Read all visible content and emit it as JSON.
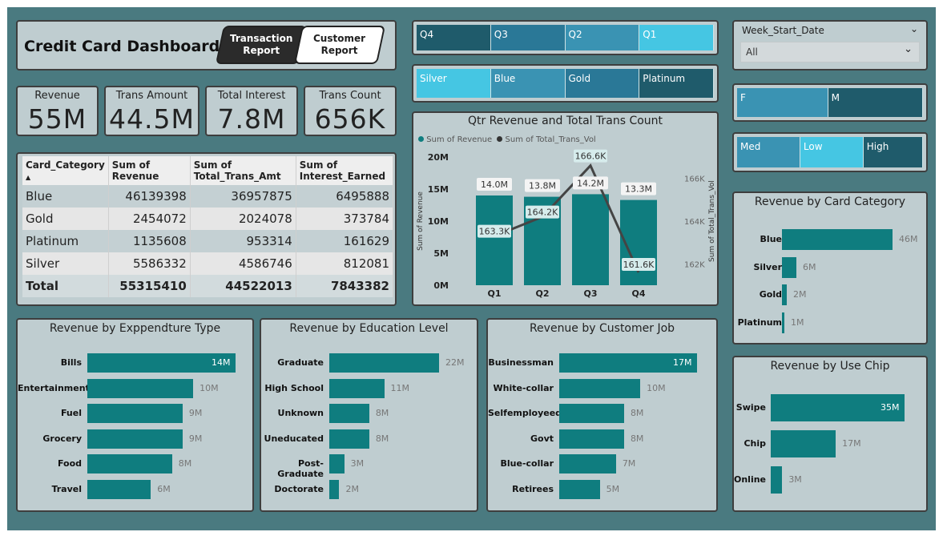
{
  "header": {
    "title": "Credit Card Dashboard",
    "nav": [
      "Transaction\nReport",
      "Customer\nReport"
    ]
  },
  "kpis": [
    {
      "label": "Revenue",
      "value": "55M"
    },
    {
      "label": "Trans Amount",
      "value": "44.5M"
    },
    {
      "label": "Total Interest",
      "value": "7.8M"
    },
    {
      "label": "Trans Count",
      "value": "656K"
    }
  ],
  "table": {
    "headers": [
      "Card_Category",
      "Sum of Revenue",
      "Sum of\nTotal_Trans_Amt",
      "Sum of\nInterest_Earned"
    ],
    "sort_glyph": "▲",
    "rows": [
      [
        "Blue",
        "46139398",
        "36957875",
        "6495888"
      ],
      [
        "Gold",
        "2454072",
        "2024078",
        "373784"
      ],
      [
        "Platinum",
        "1135608",
        "953314",
        "161629"
      ],
      [
        "Silver",
        "5586332",
        "4586746",
        "812081"
      ]
    ],
    "total": [
      "Total",
      "55315410",
      "44522013",
      "7843382"
    ]
  },
  "slicers": {
    "quarters": [
      "Q4",
      "Q3",
      "Q2",
      "Q1"
    ],
    "cards": [
      "Silver",
      "Blue",
      "Gold",
      "Platinum"
    ],
    "week": {
      "label": "Week_Start_Date",
      "value": "All"
    },
    "gender": [
      "F",
      "M"
    ],
    "income": [
      "Med",
      "Low",
      "High"
    ]
  },
  "colors": {
    "accent": "#0f7d7f",
    "dark_tile": "#1f5b6b",
    "mid_tile": "#3a93b3",
    "light_tile": "#45c6e3"
  },
  "chart_data": [
    {
      "type": "bar",
      "title": "Qtr Revenue and Total Trans Count",
      "categories": [
        "Q1",
        "Q2",
        "Q3",
        "Q4"
      ],
      "legend": [
        "Sum of Revenue",
        "Sum of Total_Trans_Vol"
      ],
      "ylabel": "Sum of Revenue",
      "y2label": "Sum of Total_Trans_Vol",
      "yticks": [
        "20M",
        "15M",
        "10M",
        "5M",
        "0M"
      ],
      "y2ticks": [
        "166K",
        "164K",
        "162K"
      ],
      "ylim": [
        0,
        20
      ],
      "y2lim": [
        161.0,
        167.0
      ],
      "series": [
        {
          "name": "Sum of Revenue",
          "type": "bar",
          "values": [
            14.0,
            13.8,
            14.2,
            13.3
          ],
          "labels": [
            "14.0M",
            "13.8M",
            "14.2M",
            "13.3M"
          ]
        },
        {
          "name": "Sum of Total_Trans_Vol",
          "type": "line",
          "values": [
            163.3,
            164.2,
            166.6,
            161.6
          ],
          "labels": [
            "163.3K",
            "164.2K",
            "166.6K",
            "161.6K"
          ]
        }
      ]
    },
    {
      "type": "bar",
      "title": "Revenue by Card Category",
      "categories": [
        "Blue",
        "Silver",
        "Gold",
        "Platinum"
      ],
      "values": [
        46,
        6,
        2,
        1
      ],
      "labels": [
        "46M",
        "6M",
        "2M",
        "1M"
      ]
    },
    {
      "type": "bar",
      "title": "Revenue by Exppendture Type",
      "categories": [
        "Bills",
        "Entertainment",
        "Fuel",
        "Grocery",
        "Food",
        "Travel"
      ],
      "values": [
        14,
        10,
        9,
        9,
        8,
        6
      ],
      "labels": [
        "14M",
        "10M",
        "9M",
        "9M",
        "8M",
        "6M"
      ]
    },
    {
      "type": "bar",
      "title": "Revenue by Education Level",
      "categories": [
        "Graduate",
        "High School",
        "Unknown",
        "Uneducated",
        "Post-Graduate",
        "Doctorate"
      ],
      "values": [
        22,
        11,
        8,
        8,
        3,
        2
      ],
      "labels": [
        "22M",
        "11M",
        "8M",
        "8M",
        "3M",
        "2M"
      ]
    },
    {
      "type": "bar",
      "title": "Revenue by Customer Job",
      "categories": [
        "Businessman",
        "White-collar",
        "Selfemployeed",
        "Govt",
        "Blue-collar",
        "Retirees"
      ],
      "values": [
        17,
        10,
        8,
        8,
        7,
        5
      ],
      "labels": [
        "17M",
        "10M",
        "8M",
        "8M",
        "7M",
        "5M"
      ]
    },
    {
      "type": "bar",
      "title": "Revenue by Use Chip",
      "categories": [
        "Swipe",
        "Chip",
        "Online"
      ],
      "values": [
        35,
        17,
        3
      ],
      "labels": [
        "35M",
        "17M",
        "3M"
      ]
    }
  ]
}
